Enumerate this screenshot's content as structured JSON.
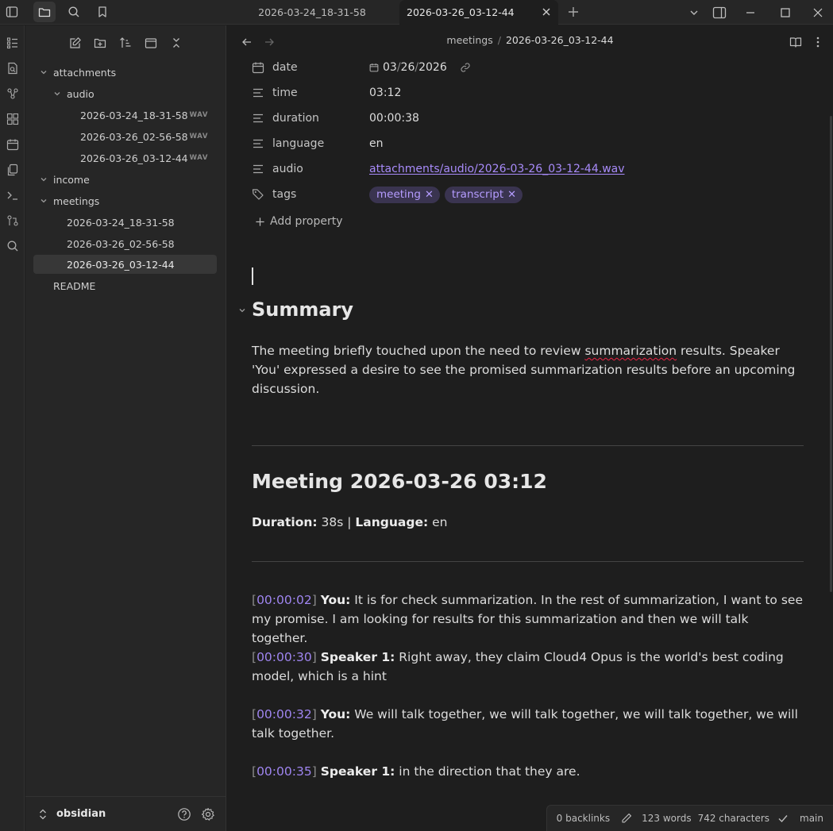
{
  "window": {
    "tabs": [
      {
        "label": "2026-03-24_18-31-58",
        "active": false
      },
      {
        "label": "2026-03-26_03-12-44",
        "active": true
      }
    ]
  },
  "sidebar": {
    "tree": [
      {
        "label": "attachments",
        "type": "folder",
        "expanded": true
      },
      {
        "label": "audio",
        "type": "folder",
        "expanded": true
      },
      {
        "label": "2026-03-24_18-31-58",
        "type": "file",
        "badge": "WAV"
      },
      {
        "label": "2026-03-26_02-56-58",
        "type": "file",
        "badge": "WAV"
      },
      {
        "label": "2026-03-26_03-12-44",
        "type": "file",
        "badge": "WAV"
      },
      {
        "label": "income",
        "type": "folder",
        "expanded": true
      },
      {
        "label": "meetings",
        "type": "folder",
        "expanded": true
      },
      {
        "label": "2026-03-24_18-31-58",
        "type": "file"
      },
      {
        "label": "2026-03-26_02-56-58",
        "type": "file"
      },
      {
        "label": "2026-03-26_03-12-44",
        "type": "file",
        "selected": true
      },
      {
        "label": "README",
        "type": "file"
      }
    ],
    "vault_name": "obsidian"
  },
  "editor": {
    "breadcrumb": {
      "folder": "meetings",
      "sep": "/",
      "file": "2026-03-26_03-12-44"
    },
    "properties": [
      {
        "key": "date",
        "icon": "calendar-icon",
        "value_month": "03",
        "value_day": "26",
        "value_year": "2026"
      },
      {
        "key": "time",
        "icon": "text-icon",
        "value": "03:12"
      },
      {
        "key": "duration",
        "icon": "text-icon",
        "value": "00:00:38"
      },
      {
        "key": "language",
        "icon": "text-icon",
        "value": "en"
      },
      {
        "key": "audio",
        "icon": "text-icon",
        "value": "attachments/audio/2026-03-26_03-12-44.wav"
      },
      {
        "key": "tags",
        "icon": "tags-icon",
        "tags": [
          "meeting",
          "transcript"
        ]
      }
    ],
    "add_property_label": "Add property",
    "summary_heading": "Summary",
    "summary_text_pre": "The meeting briefly touched upon the need to review ",
    "summary_text_word": "summarization",
    "summary_text_post": " results. Speaker 'You' expressed a desire to see the promised summarization results before an upcoming discussion.",
    "meeting_heading": "Meeting 2026-03-26 03:12",
    "duration_label": "Duration:",
    "duration_value": " 38s | ",
    "language_label": "Language:",
    "language_value": " en",
    "transcript": [
      {
        "time": "00:00:02",
        "speaker": "You:",
        "text": " It is for check summarization. In the rest of summarization, I want to see my promise. I am looking for results for this summarization and then we will talk together."
      },
      {
        "time": "00:00:30",
        "speaker": "Speaker 1:",
        "text": " Right away, they claim Cloud4 Opus is the world's best coding model, which is a hint"
      },
      {
        "time": "00:00:32",
        "speaker": "You:",
        "text": " We will talk together, we will talk together, we will talk together, we will talk together."
      },
      {
        "time": "00:00:35",
        "speaker": "Speaker 1:",
        "text": " in the direction that they are."
      }
    ]
  },
  "status_bar": {
    "backlinks": "0 backlinks",
    "words": "123 words",
    "characters": "742 characters",
    "branch": "main"
  },
  "colors": {
    "accent": "#a88bfa",
    "tag_bg": "#3a3450",
    "background": "#1e1e1e",
    "panel": "#262626"
  }
}
